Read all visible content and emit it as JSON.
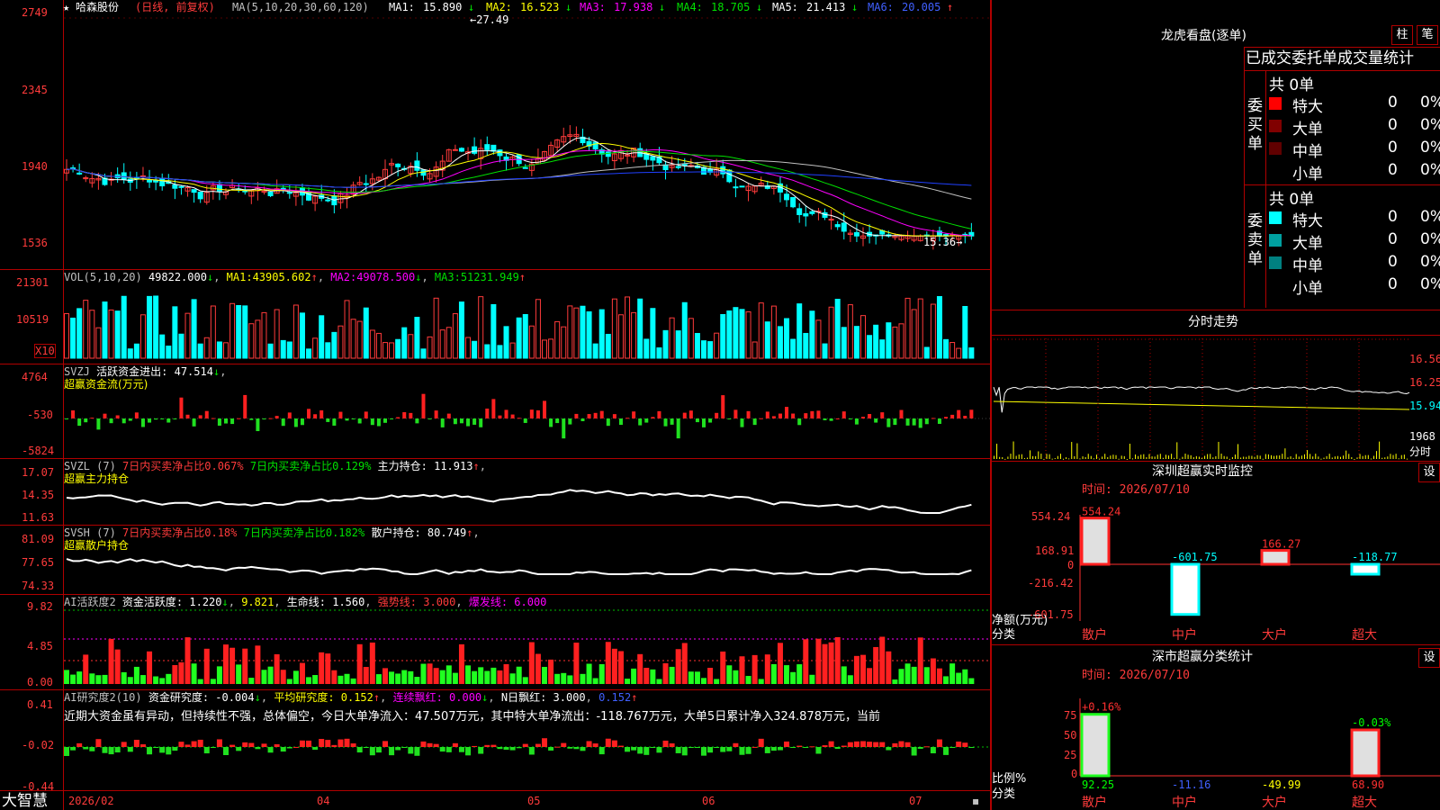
{
  "stock": {
    "star": "★",
    "name": "哈森股份",
    "mode": "(日线, 前复权)",
    "ma_label": "MA(5,10,20,30,60,120)",
    "ma": [
      {
        "name": "MA1:",
        "value": "15.890",
        "arrow": "↓"
      },
      {
        "name": "MA2:",
        "value": "16.523",
        "arrow": "↓"
      },
      {
        "name": "MA3:",
        "value": "17.938",
        "arrow": "↓"
      },
      {
        "name": "MA4:",
        "value": "18.705",
        "arrow": "↓"
      },
      {
        "name": "MA5:",
        "value": "21.413",
        "arrow": "↓"
      },
      {
        "name": "MA6:",
        "value": "20.005",
        "arrow": "↑"
      }
    ],
    "y_labels": [
      "2749",
      "2345",
      "1940",
      "1536"
    ],
    "high_marker": "27.49",
    "low_marker": "15.36"
  },
  "vol": {
    "label": "VOL(5,10,20)",
    "value": "49822.000",
    "arrow": "↓",
    "ma1_label": "MA1:",
    "ma1": "43905.602",
    "ma1_arrow": "↑",
    "ma2_label": "MA2:",
    "ma2": "49078.500",
    "ma2_arrow": "↓",
    "ma3_label": "MA3:",
    "ma3": "51231.949",
    "ma3_arrow": "↑",
    "y_labels": [
      "21301",
      "10519"
    ],
    "unit": "X10"
  },
  "svzj": {
    "label": "SVZJ",
    "desc": "活跃资金进出: 47.514",
    "arrow": "↓",
    "title": "超赢资金流(万元)",
    "y_labels": [
      "4764",
      "-530",
      "-5824"
    ]
  },
  "svzl": {
    "label": "SVZL (7)",
    "t1": "7日内买卖净占比0.067%",
    "t2": "7日内买卖净占比0.129%",
    "t3": "主力持仓: 11.913",
    "t3_arrow": "↑",
    "title": "超赢主力持仓",
    "y_labels": [
      "17.07",
      "14.35",
      "11.63"
    ]
  },
  "svsh": {
    "label": "SVSH (7)",
    "t1": "7日内买卖净占比0.18%",
    "t2": "7日内买卖净占比0.182%",
    "t3": "散户持仓: 80.749",
    "t3_arrow": "↑",
    "title": "超赢散户持仓",
    "y_labels": [
      "81.09",
      "77.65",
      "74.33"
    ]
  },
  "ai1": {
    "label": "AI活跃度2",
    "t1": "资金活跃度: 1.220",
    "t1_arrow": "↓",
    "t2": "9.821",
    "t3": "生命线: 1.560",
    "t4": "强势线: 3.000",
    "t5": "爆发线: 6.000",
    "y_labels": [
      "9.82",
      "4.85",
      "0.00"
    ]
  },
  "ai2": {
    "label": "AI研究度2(10)",
    "t1": "资金研究度: -0.004",
    "t1_arrow": "↓",
    "t2": "平均研究度: 0.152",
    "t2_arrow": "↑",
    "t3": "连续飘红: 0.000",
    "t3_arrow": "↓",
    "t4": "N日飘红: 3.000",
    "t5": "0.152",
    "t5_arrow": "↑",
    "text": "近期大资金虽有异动，但持续性不强，总体偏空，今日大单净流入：47.507万元，其中特大单净流出：-118.767万元，大单5日累计净入324.878万元，当前",
    "y_labels": [
      "0.41",
      "-0.02",
      "-0.44"
    ]
  },
  "axis": {
    "brand": "大智慧",
    "dates": [
      "2026/02",
      "04",
      "05",
      "06",
      "07"
    ]
  },
  "dragon": {
    "title": "龙虎看盘(逐单)",
    "btn1": "柱",
    "btn2": "笔",
    "tabs": [
      "已成交",
      "委托单",
      "成交量统计"
    ],
    "buy": {
      "side": "委买单",
      "total": "共 0单",
      "rows": [
        {
          "label": "特大",
          "count": "0",
          "pct": "0%",
          "color": "#ff0000"
        },
        {
          "label": "大单",
          "count": "0",
          "pct": "0%",
          "color": "#800000"
        },
        {
          "label": "中单",
          "count": "0",
          "pct": "0%",
          "color": "#600000"
        },
        {
          "label": "小单",
          "count": "0",
          "pct": "0%",
          "color": "#000000"
        }
      ]
    },
    "sell": {
      "side": "委卖单",
      "total": "共 0单",
      "rows": [
        {
          "label": "特大",
          "count": "0",
          "pct": "0%",
          "color": "#00ffff"
        },
        {
          "label": "大单",
          "count": "0",
          "pct": "0%",
          "color": "#00a0a0"
        },
        {
          "label": "中单",
          "count": "0",
          "pct": "0%",
          "color": "#008080"
        },
        {
          "label": "小单",
          "count": "0",
          "pct": "0%",
          "color": "#000000"
        }
      ]
    }
  },
  "intraday": {
    "title": "分时走势",
    "prices": [
      "16.56",
      "16.25",
      "15.94"
    ],
    "vol": "1968",
    "footer": "分时"
  },
  "monitor": {
    "title": "深圳超赢实时监控",
    "btn": "设",
    "time": "时间: 2026/07/10",
    "y_labels": [
      "554.24",
      "168.91",
      "0",
      "-216.42",
      "-601.75"
    ],
    "ylabel": "净额(万元)",
    "xlabel": "分类",
    "categories": [
      "散户",
      "中户",
      "大户",
      "超大"
    ],
    "values": [
      554.24,
      -601.75,
      166.27,
      -118.77
    ],
    "value_labels": [
      "554.24",
      "-601.75",
      "166.27",
      "-118.77"
    ]
  },
  "classify": {
    "title": "深市超赢分类统计",
    "btn": "设",
    "time": "时间: 2026/07/10",
    "y_labels": [
      "75",
      "50",
      "25",
      "0"
    ],
    "ylabel": "比例%",
    "xlabel": "分类",
    "categories": [
      "散户",
      "中户",
      "大户",
      "超大"
    ],
    "top_labels": [
      "+0.16%",
      "",
      "",
      "-0.03%"
    ],
    "bottom_labels": [
      "92.25",
      "-11.16",
      "-49.99",
      "68.90"
    ]
  },
  "chart_data": [
    {
      "type": "bar",
      "title": "深圳超赢实时监控",
      "categories": [
        "散户",
        "中户",
        "大户",
        "超大"
      ],
      "values": [
        554.24,
        -601.75,
        166.27,
        -118.77
      ],
      "ylabel": "净额(万元)",
      "xlabel": "分类",
      "ylim": [
        -601.75,
        554.24
      ]
    },
    {
      "type": "bar",
      "title": "深市超赢分类统计",
      "categories": [
        "散户",
        "中户",
        "大户",
        "超大"
      ],
      "values": [
        92.25,
        0,
        0,
        68.9
      ],
      "ylabel": "比例%",
      "xlabel": "分类",
      "ylim": [
        0,
        100
      ]
    }
  ]
}
